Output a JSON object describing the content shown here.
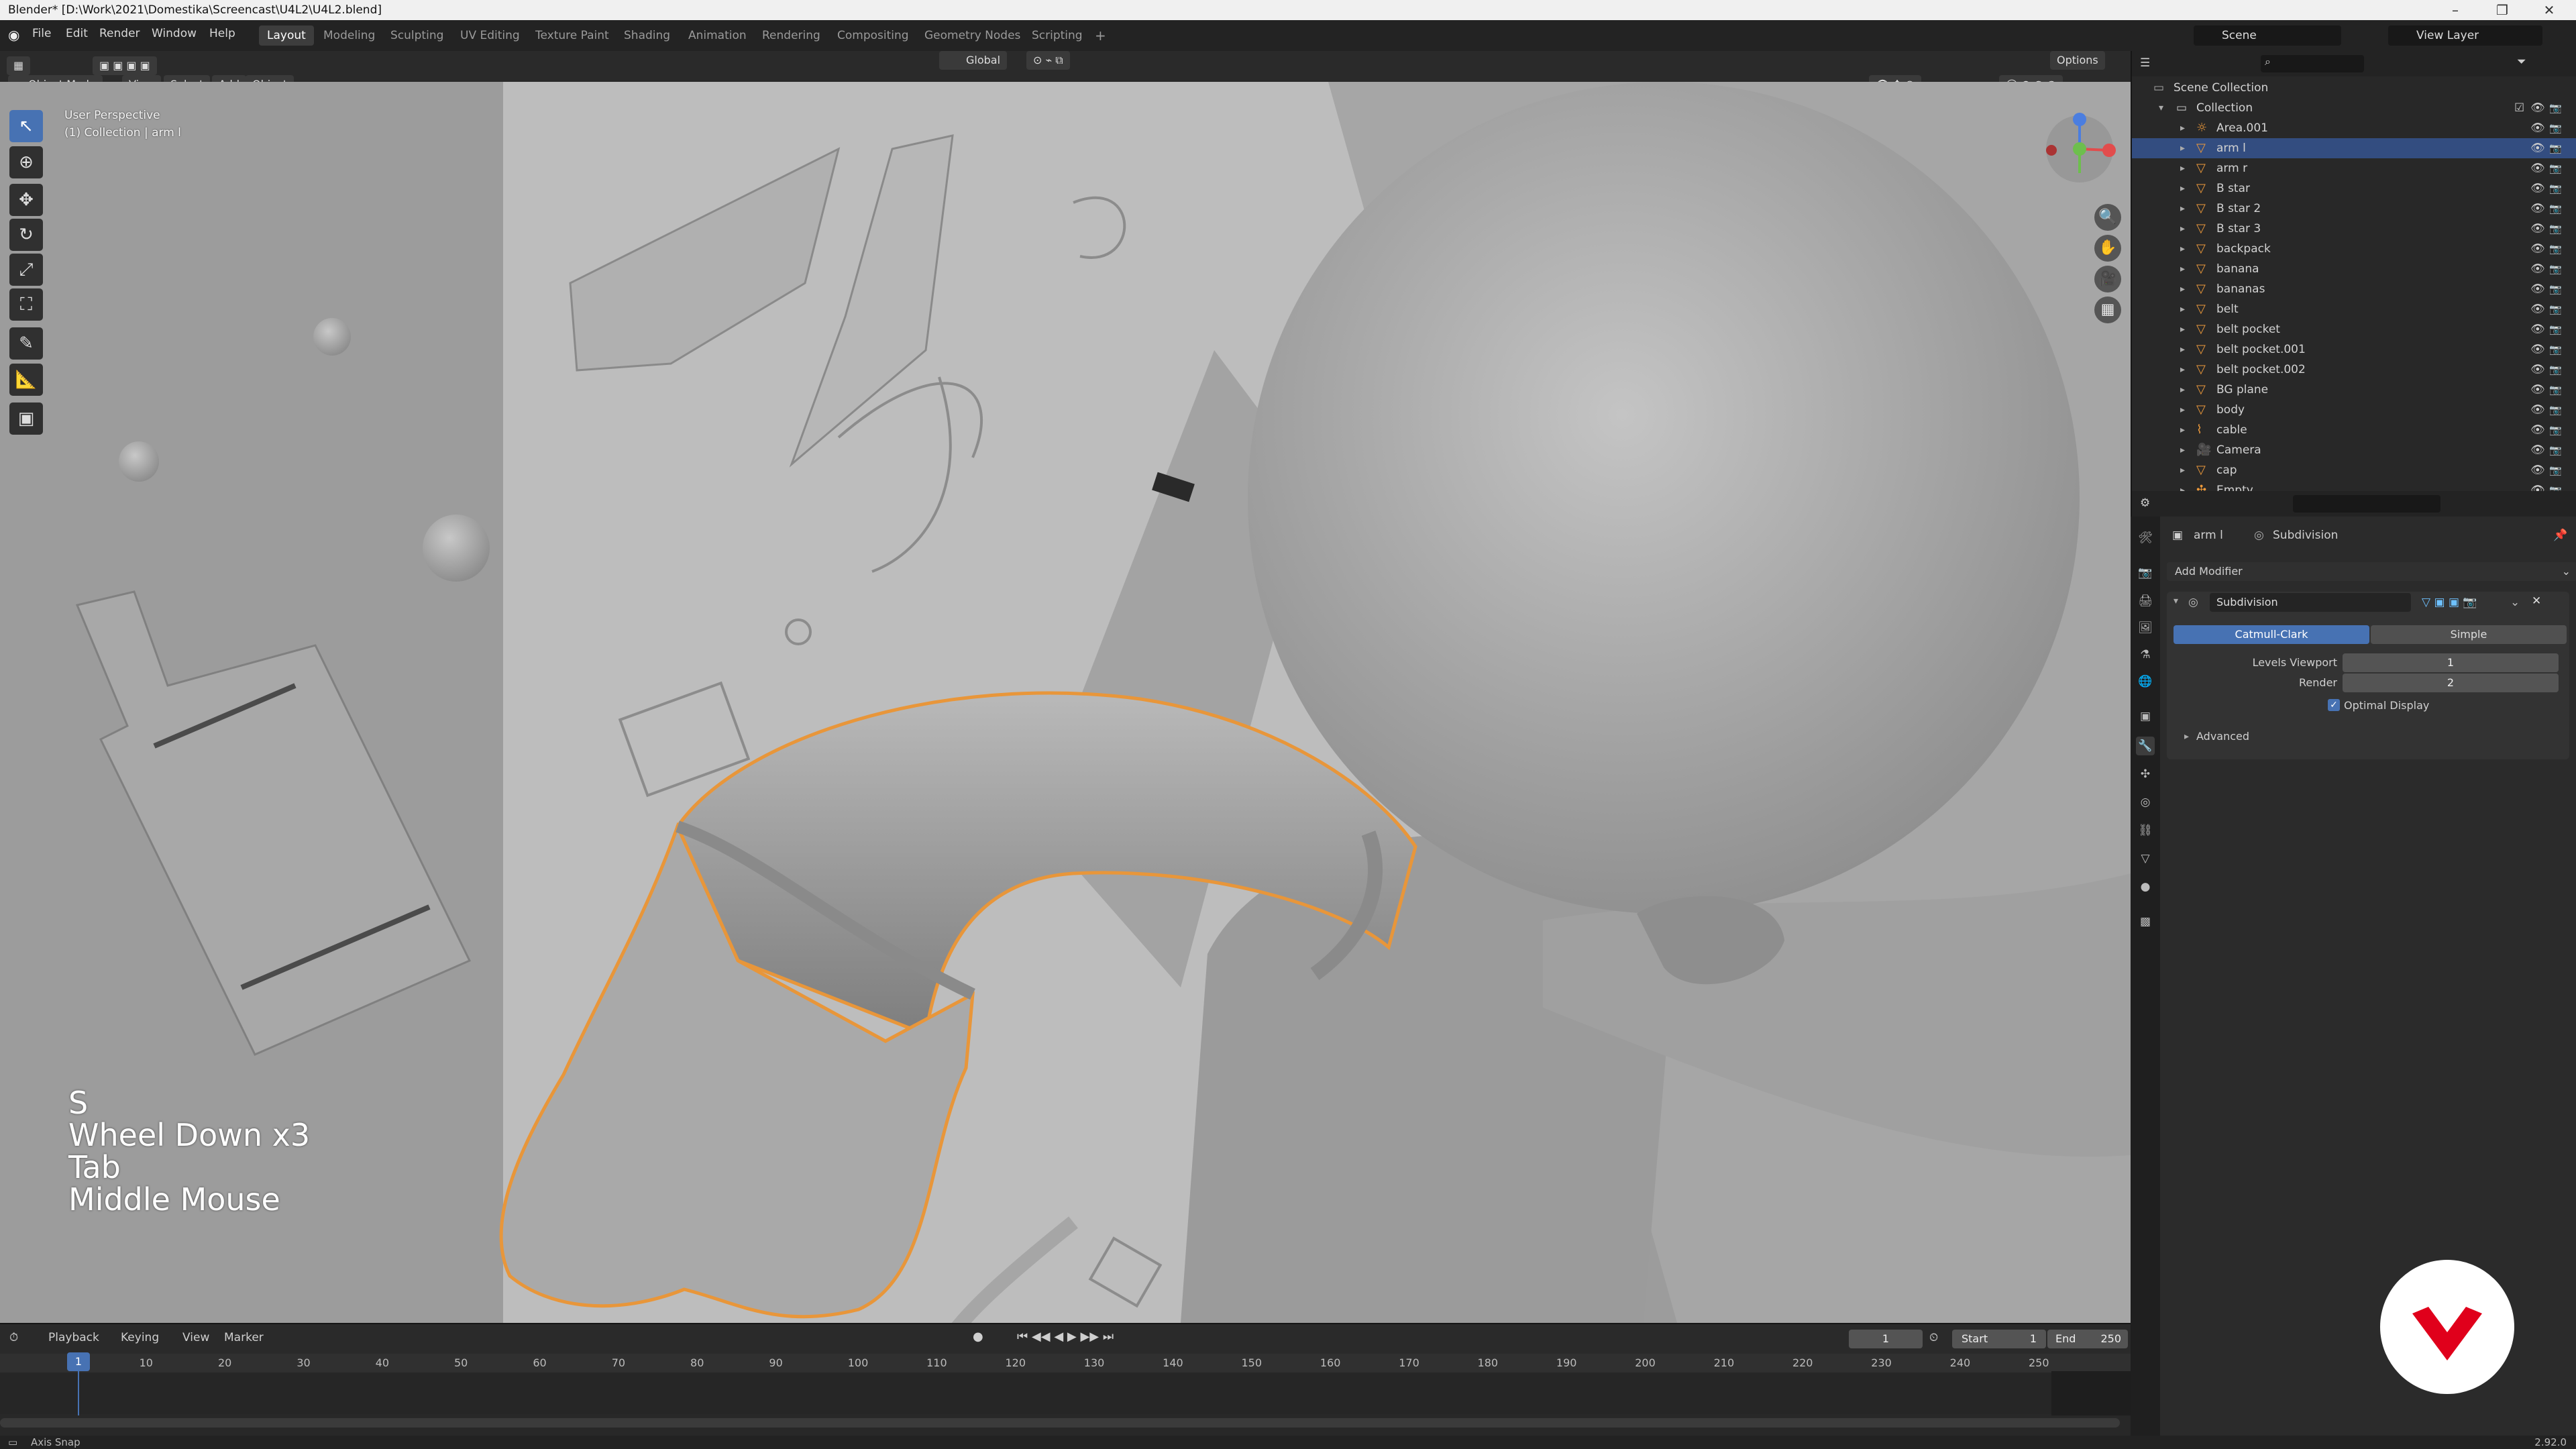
{
  "title_bar": {
    "title": "Blender* [D:\\Work\\2021\\Domestika\\Screencast\\U4L2\\U4L2.blend]"
  },
  "menu": [
    "File",
    "Edit",
    "Render",
    "Window",
    "Help"
  ],
  "workspaces": [
    "Layout",
    "Modeling",
    "Sculpting",
    "UV Editing",
    "Texture Paint",
    "Shading",
    "Animation",
    "Rendering",
    "Compositing",
    "Geometry Nodes",
    "Scripting"
  ],
  "active_workspace": "Layout",
  "scene": {
    "scene_name": "Scene",
    "view_layer": "View Layer"
  },
  "viewport_header": {
    "mode": "Object Mode",
    "menus": [
      "View",
      "Select",
      "Add",
      "Object"
    ],
    "transform_orientation": "Global",
    "options": "Options"
  },
  "viewport": {
    "perspective_label": "User Perspective",
    "collection_label": "(1) Collection | arm l",
    "key_overlay": [
      "S",
      "Wheel Down x3",
      "Tab",
      "Middle Mouse"
    ]
  },
  "outliner": {
    "root": "Scene Collection",
    "collection": "Collection",
    "items": [
      {
        "name": "Area.001",
        "icon": "light-icon",
        "selected": false
      },
      {
        "name": "arm l",
        "icon": "mesh-icon",
        "selected": true
      },
      {
        "name": "arm r",
        "icon": "mesh-icon",
        "selected": false
      },
      {
        "name": "B star",
        "icon": "mesh-icon",
        "selected": false
      },
      {
        "name": "B star 2",
        "icon": "mesh-icon",
        "selected": false
      },
      {
        "name": "B star 3",
        "icon": "mesh-icon",
        "selected": false
      },
      {
        "name": "backpack",
        "icon": "mesh-icon",
        "selected": false
      },
      {
        "name": "banana",
        "icon": "mesh-icon",
        "selected": false
      },
      {
        "name": "bananas",
        "icon": "mesh-icon",
        "selected": false
      },
      {
        "name": "belt",
        "icon": "mesh-icon",
        "selected": false
      },
      {
        "name": "belt pocket",
        "icon": "mesh-icon",
        "selected": false
      },
      {
        "name": "belt pocket.001",
        "icon": "mesh-icon",
        "selected": false
      },
      {
        "name": "belt pocket.002",
        "icon": "mesh-icon",
        "selected": false
      },
      {
        "name": "BG plane",
        "icon": "mesh-icon",
        "selected": false
      },
      {
        "name": "body",
        "icon": "mesh-icon",
        "selected": false
      },
      {
        "name": "cable",
        "icon": "curve-icon",
        "selected": false
      },
      {
        "name": "Camera",
        "icon": "camera-icon",
        "selected": false
      },
      {
        "name": "cap",
        "icon": "mesh-icon",
        "selected": false
      },
      {
        "name": "Empty",
        "icon": "empty-icon",
        "selected": false
      }
    ]
  },
  "properties": {
    "object_name": "arm l",
    "modifier_context": "Subdivision",
    "add_modifier": "Add Modifier",
    "modifier": {
      "name": "Subdivision",
      "type_options": [
        "Catmull-Clark",
        "Simple"
      ],
      "active_type": "Catmull-Clark",
      "levels_viewport_label": "Levels Viewport",
      "levels_viewport": "1",
      "render_label": "Render",
      "render": "2",
      "optimal_display_label": "Optimal Display",
      "optimal_display": true,
      "advanced_label": "Advanced"
    }
  },
  "timeline": {
    "menus": [
      "Playback",
      "Keying",
      "View",
      "Marker"
    ],
    "current_frame": "1",
    "start_label": "Start",
    "start": "1",
    "end_label": "End",
    "end": "250",
    "ticks": [
      "1",
      "10",
      "20",
      "30",
      "40",
      "50",
      "60",
      "70",
      "80",
      "90",
      "100",
      "110",
      "120",
      "130",
      "140",
      "150",
      "160",
      "170",
      "180",
      "190",
      "200",
      "210",
      "220",
      "230",
      "240",
      "250"
    ]
  },
  "status_bar": {
    "left": "Axis Snap",
    "version": "2.92.0"
  },
  "colors": {
    "accent": "#4772b3",
    "selection_outline": "#e8963a",
    "logo_red": "#e0001b"
  }
}
